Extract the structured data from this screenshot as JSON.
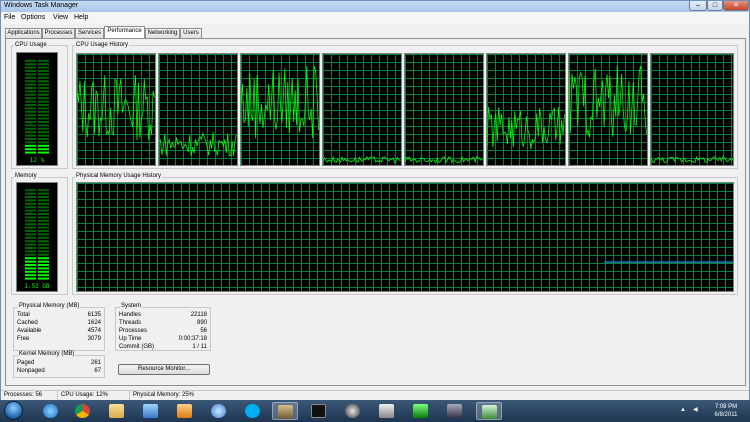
{
  "window": {
    "title": "Windows Task Manager"
  },
  "menu": [
    "File",
    "Options",
    "View",
    "Help"
  ],
  "tabs": [
    "Applications",
    "Processes",
    "Services",
    "Performance",
    "Networking",
    "Users"
  ],
  "active_tab": "Performance",
  "cpu": {
    "label": "CPU Usage",
    "history_label": "CPU Usage History",
    "value": "12 %",
    "fraction": 0.12
  },
  "memory": {
    "label": "Memory",
    "history_label": "Physical Memory Usage History",
    "value": "1.52 GB",
    "fraction": 0.25
  },
  "physical_memory": {
    "title": "Physical Memory (MB)",
    "rows": [
      {
        "k": "Total",
        "v": "6135"
      },
      {
        "k": "Cached",
        "v": "1624"
      },
      {
        "k": "Available",
        "v": "4574"
      },
      {
        "k": "Free",
        "v": "3079"
      }
    ]
  },
  "system": {
    "title": "System",
    "rows": [
      {
        "k": "Handles",
        "v": "22118"
      },
      {
        "k": "Threads",
        "v": "890"
      },
      {
        "k": "Processes",
        "v": "56"
      },
      {
        "k": "Up Time",
        "v": "0:00:37:18"
      },
      {
        "k": "Commit (GB)",
        "v": "1 / 11"
      }
    ]
  },
  "kernel_memory": {
    "title": "Kernel Memory (MB)",
    "rows": [
      {
        "k": "Paged",
        "v": "261"
      },
      {
        "k": "Nonpaged",
        "v": "67"
      }
    ]
  },
  "resource_monitor_label": "Resource Monitor...",
  "status": {
    "processes": "Processes: 56",
    "cpu": "CPU Usage: 12%",
    "memory": "Physical Memory: 25%"
  },
  "clock": {
    "time": "7:08 PM",
    "date": "6/8/2011"
  },
  "colors": {
    "graph_bg": "#000000",
    "grid": "#008040",
    "cpu_line": "#00ff00",
    "mem_line": "#2aa0ff"
  },
  "taskbar_icons": [
    "start-orb-icon",
    "ie-icon",
    "chrome-icon",
    "explorer-folder-icon",
    "media-player-icon",
    "media-center-icon",
    "itunes-icon",
    "skype-icon",
    "game-icon",
    "console-icon",
    "steam-icon",
    "disc-tool-icon",
    "fraps-icon",
    "game-character-icon",
    "task-manager-icon"
  ]
}
